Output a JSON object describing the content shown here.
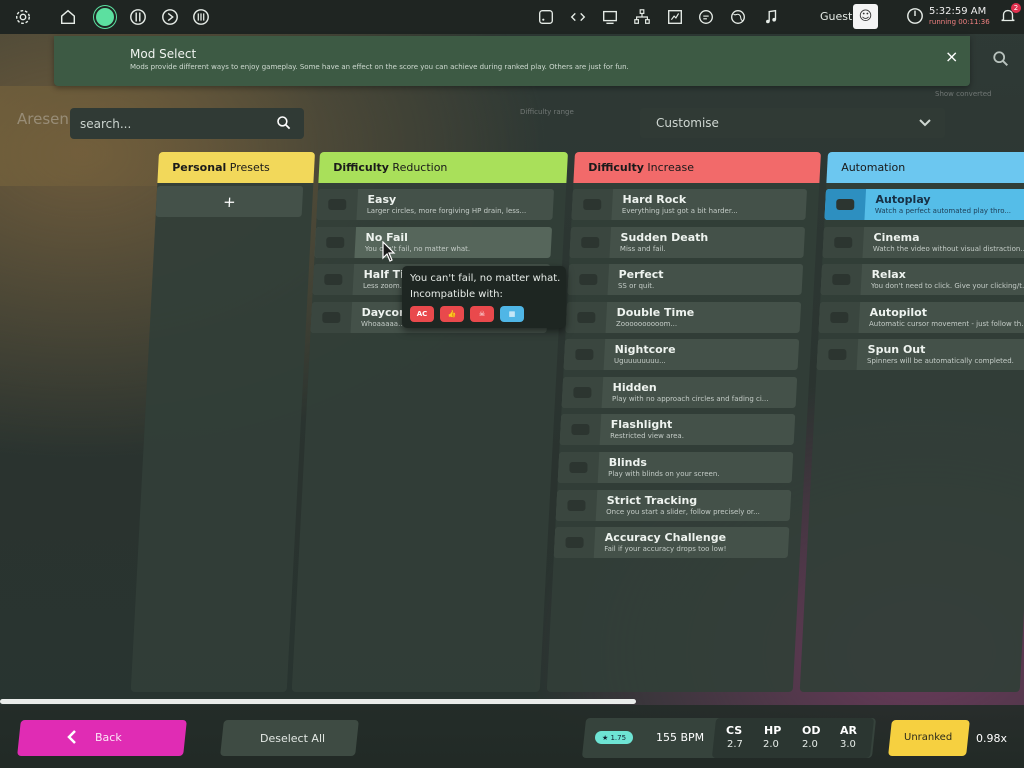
{
  "toolbar": {
    "icons": [
      "settings-icon",
      "home-icon",
      "mode-standard-icon",
      "mode-taiko-icon",
      "mode-catch-icon",
      "mode-mania-icon",
      "rss-icon",
      "code-icon",
      "monitor-icon",
      "tree-icon",
      "chart-icon",
      "chat-icon",
      "globe-icon",
      "music-icon"
    ],
    "user": "Guest",
    "time": "5:32:59 AM",
    "running": "running 00:11:36",
    "notification_count": "2"
  },
  "header": {
    "title": "Mod Select",
    "subtitle": "Mods provide different ways to enjoy gameplay. Some have an effect on the score you can achieve during ranked play. Others are just for fun.",
    "close_label": "×"
  },
  "background": {
    "song_title": "Aresen",
    "search_placeholder": "search...",
    "customise_label": "Customise",
    "difficulty_range_label": "Difficulty range",
    "unconverted_label": "Show converted"
  },
  "columns": {
    "personal": {
      "title_bold": "Personal",
      "title_rest": " Presets",
      "color": "#f2d85a",
      "add_label": "+"
    },
    "reduction": {
      "title_bold": "Difficulty",
      "title_rest": " Reduction",
      "color": "#a9e05a",
      "mods": [
        {
          "name": "Easy",
          "desc": "Larger circles, more forgiving HP drain, less..."
        },
        {
          "name": "No Fail",
          "desc": "You can't fail, no matter what."
        },
        {
          "name": "Half Time",
          "desc": "Less zoom..."
        },
        {
          "name": "Daycore",
          "desc": "Whoaaaaa..."
        }
      ]
    },
    "increase": {
      "title_bold": "Difficulty",
      "title_rest": " Increase",
      "color": "#f26a6a",
      "mods": [
        {
          "name": "Hard Rock",
          "desc": "Everything just got a bit harder..."
        },
        {
          "name": "Sudden Death",
          "desc": "Miss and fail."
        },
        {
          "name": "Perfect",
          "desc": "SS or quit."
        },
        {
          "name": "Double Time",
          "desc": "Zoooooooooom..."
        },
        {
          "name": "Nightcore",
          "desc": "Uguuuuuuuu..."
        },
        {
          "name": "Hidden",
          "desc": "Play with no approach circles and fading ci..."
        },
        {
          "name": "Flashlight",
          "desc": "Restricted view area."
        },
        {
          "name": "Blinds",
          "desc": "Play with blinds on your screen."
        },
        {
          "name": "Strict Tracking",
          "desc": "Once you start a slider, follow precisely or..."
        },
        {
          "name": "Accuracy Challenge",
          "desc": "Fail if your accuracy drops too low!"
        }
      ]
    },
    "automation": {
      "title_bold": "",
      "title_rest": "Automation",
      "color": "#6cc7f0",
      "mods": [
        {
          "name": "Autoplay",
          "desc": "Watch a perfect automated play thro..."
        },
        {
          "name": "Cinema",
          "desc": "Watch the video without visual distraction..."
        },
        {
          "name": "Relax",
          "desc": "You don't need to click. Give your clicking/t..."
        },
        {
          "name": "Autopilot",
          "desc": "Automatic cursor movement - just follow th..."
        },
        {
          "name": "Spun Out",
          "desc": "Spinners will be automatically completed."
        }
      ]
    }
  },
  "tooltip": {
    "line1": "You can't fail, no matter what.",
    "line2": "Incompatible with:",
    "badges": [
      {
        "label": "AC",
        "color": "#e9494c"
      },
      {
        "label": "👍",
        "color": "#e9494c"
      },
      {
        "label": "☠",
        "color": "#e9494c"
      },
      {
        "label": "▦",
        "color": "#4fb6e6"
      }
    ]
  },
  "footer": {
    "back_label": "Back",
    "deselect_label": "Deselect All",
    "star_rating": "★ 1.75",
    "bpm": "155 BPM",
    "stats": [
      {
        "label": "CS",
        "value": "2.7"
      },
      {
        "label": "HP",
        "value": "2.0"
      },
      {
        "label": "OD",
        "value": "2.0"
      },
      {
        "label": "AR",
        "value": "3.0"
      }
    ],
    "ranked_status": "Unranked",
    "multiplier": "0.98x"
  },
  "colors": {
    "accent": "#5ce0a0",
    "header_bg": "#3d5a44",
    "back": "#e02cb4",
    "unranked": "#f6d040"
  }
}
